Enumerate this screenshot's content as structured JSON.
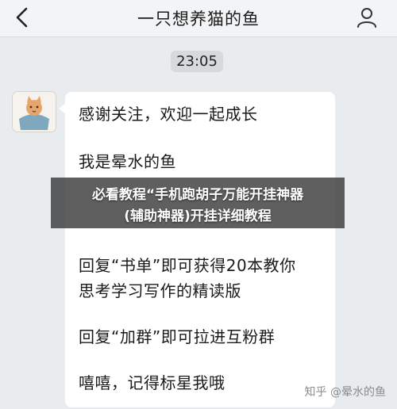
{
  "header": {
    "title": "一只想养猫的鱼",
    "back_icon": "chevron-left-icon",
    "profile_icon": "person-icon"
  },
  "chat": {
    "timestamp": "23:05",
    "avatar_icon": "cartoon-cat-avatar",
    "message_lines": [
      "感谢关注，欢迎一起成长",
      "我是晕水的鱼",
      "回复“书单”即可获得20本教你",
      "思考学习写作的精读版",
      "回复“加群”即可拉进互粉群",
      "嘻嘻，记得标星我哦"
    ]
  },
  "overlay": {
    "line1": "必看教程“手机跑胡子万能开挂神器",
    "line2": "(辅助神器)开挂详细教程"
  },
  "watermark": {
    "text": "知乎 @晕水的鱼"
  },
  "colors": {
    "background": "#e9ecef",
    "header": "#f2f4f6",
    "bubble": "#ffffff",
    "overlay": "#323232"
  }
}
